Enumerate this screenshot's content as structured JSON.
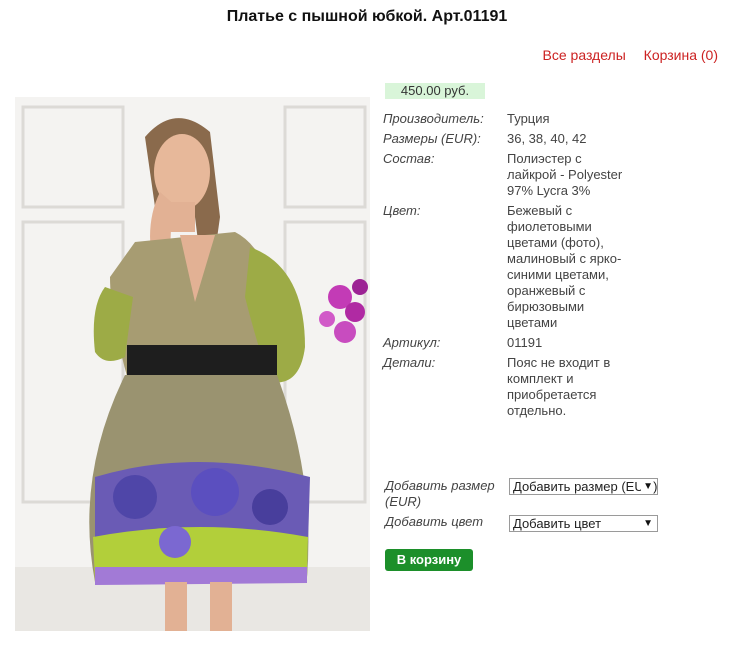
{
  "page": {
    "title": "Платье с пышной юбкой. Арт.01191"
  },
  "nav": {
    "all_sections": "Все разделы",
    "cart": "Корзина (0)"
  },
  "product": {
    "price": "450.00 руб.",
    "specs": [
      {
        "label": "Производитель:",
        "value": "Турция"
      },
      {
        "label": "Размеры (EUR):",
        "value": "36, 38, 40, 42"
      },
      {
        "label": "Состав:",
        "value": "Полиэстер с лайкрой - Polyester 97% Lycra 3%"
      },
      {
        "label": "Цвет:",
        "value": "Бежевый с фиолетовыми цветами (фото), малиновый с ярко-синими цветами, оранжевый с бирюзовыми цветами"
      },
      {
        "label": "Артикул:",
        "value": "01191"
      },
      {
        "label": "Детали:",
        "value": "Пояс не входит в комплект и приобретается отдельно."
      }
    ]
  },
  "form": {
    "size_label": "Добавить размер (EUR)",
    "size_value": "Добавить размер (EUR)",
    "color_label": "Добавить цвет",
    "color_value": "Добавить цвет",
    "add_to_cart": "В корзину"
  },
  "colors": {
    "link": "#cc2222",
    "button": "#1c8f2a",
    "price_bg": "#d9f5d9"
  }
}
